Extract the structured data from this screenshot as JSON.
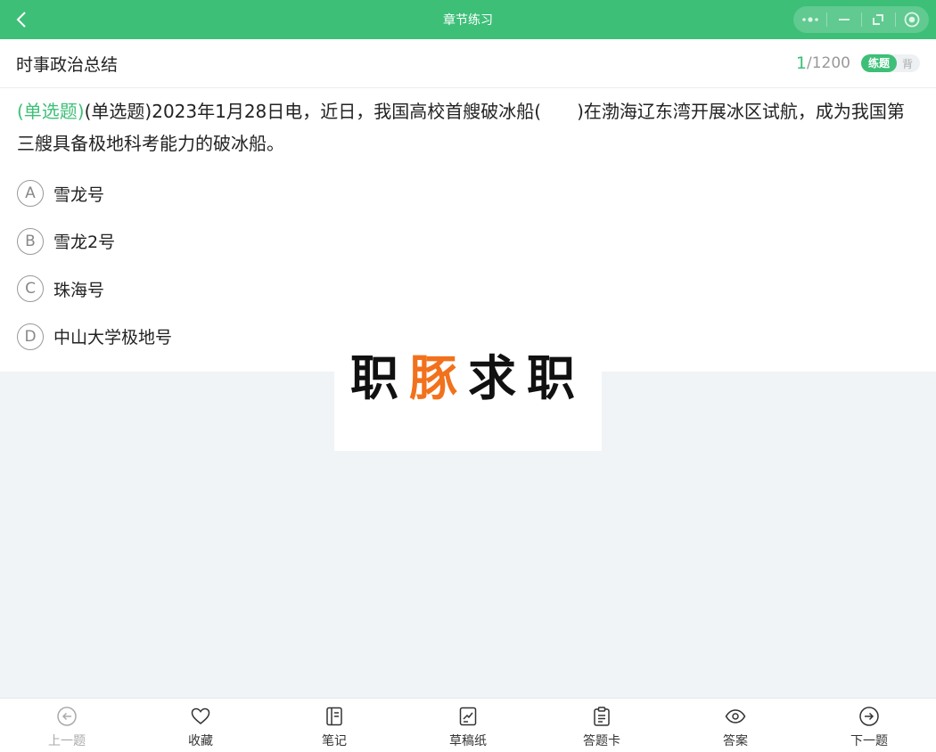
{
  "topbar": {
    "title": "章节练习",
    "back_icon": "chevron-left-icon",
    "capsule_icons": [
      "more-icon",
      "minimize-icon",
      "restore-icon",
      "close-icon"
    ]
  },
  "header": {
    "chapter_title": "时事政治总结",
    "progress_current": "1",
    "progress_total": "/1200",
    "mode_active": "练题",
    "mode_inactive": "背"
  },
  "question": {
    "type_label": "(单选题)",
    "text": "(单选题)2023年1月28日电，近日，我国高校首艘破冰船(　　)在渤海辽东湾开展冰区试航，成为我国第三艘具备极地科考能力的破冰船。",
    "options": [
      {
        "letter": "A",
        "text": "雪龙号"
      },
      {
        "letter": "B",
        "text": "雪龙2号"
      },
      {
        "letter": "C",
        "text": "珠海号"
      },
      {
        "letter": "D",
        "text": "中山大学极地号"
      }
    ]
  },
  "watermark": {
    "part1": "职",
    "part2": "豚",
    "part3": "求职"
  },
  "bottombar": {
    "prev": "上一题",
    "favorite": "收藏",
    "notes": "笔记",
    "scratch": "草稿纸",
    "answer_card": "答题卡",
    "answer": "答案",
    "next": "下一题"
  },
  "colors": {
    "accent": "#3dbf78",
    "watermark_orange": "#f2711c",
    "background": "#f0f4f7"
  }
}
